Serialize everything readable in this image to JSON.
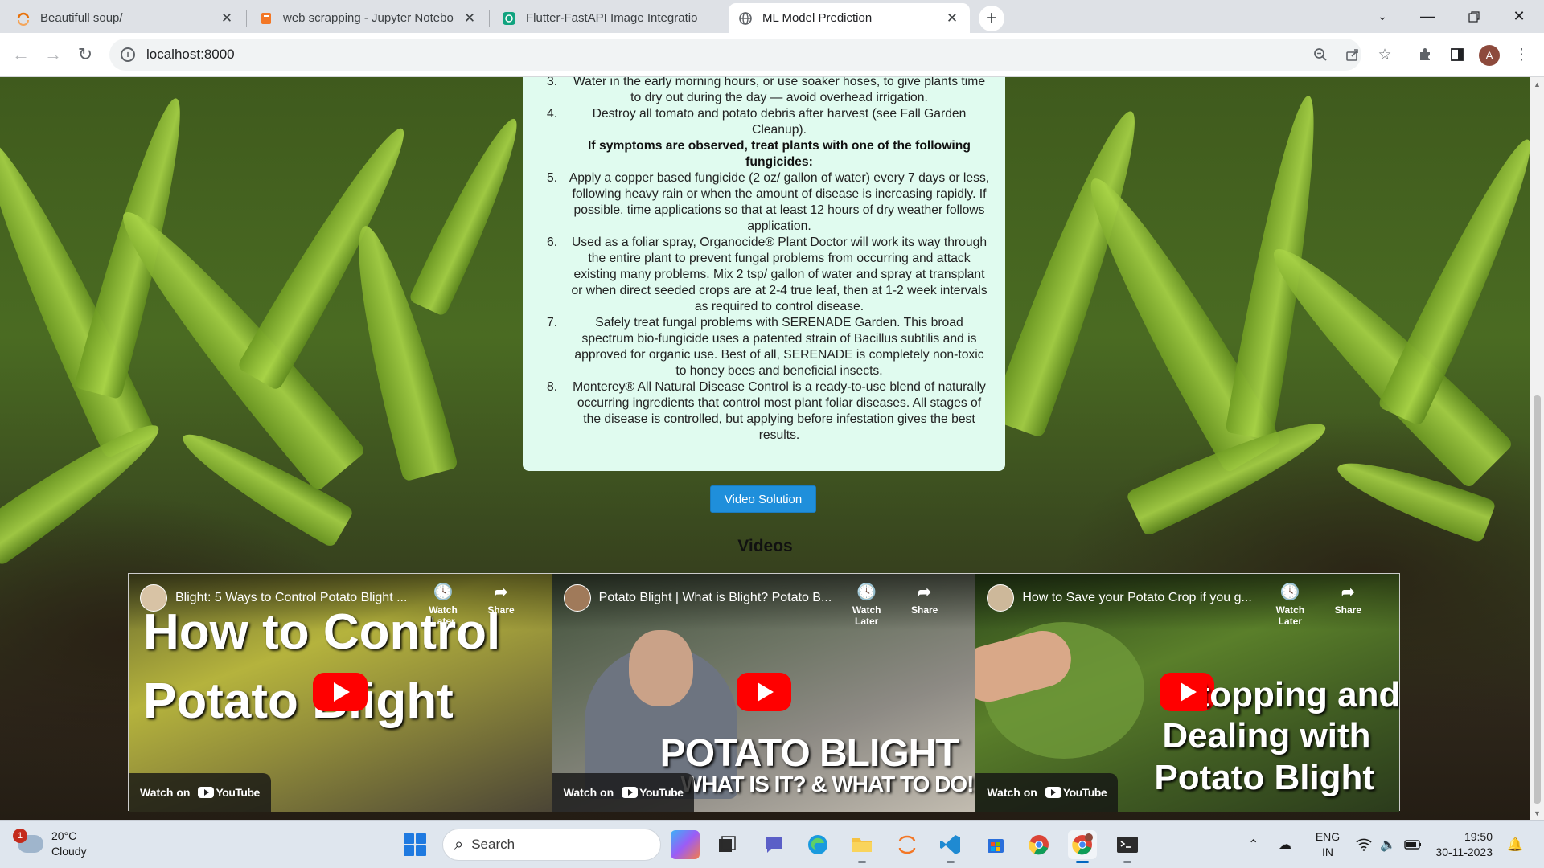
{
  "browser": {
    "tabs": [
      {
        "label": "Beautifull soup/",
        "icon": "spinner-icon"
      },
      {
        "label": "web scrapping - Jupyter Notebo",
        "icon": "jupyter-icon"
      },
      {
        "label": "Flutter-FastAPI Image Integratio",
        "icon": "chatgpt-icon"
      },
      {
        "label": "ML Model Prediction",
        "icon": "globe-icon",
        "active": true
      }
    ],
    "url": "localhost:8000",
    "avatar_letter": "A"
  },
  "card": {
    "items": [
      {
        "num": "3.",
        "text": "Water in the early morning hours, or use soaker hoses, to give plants time to dry out during the day — avoid overhead irrigation."
      },
      {
        "num": "4.",
        "text": "Destroy all tomato and potato debris after harvest (see Fall Garden Cleanup)."
      }
    ],
    "subheading": "If symptoms are observed, treat plants with one of the following fungicides:",
    "items2": [
      {
        "num": "5.",
        "text": "Apply a copper based fungicide (2 oz/ gallon of water) every 7 days or less, following heavy rain or when the amount of disease is increasing rapidly. If possible, time applications so that at least 12 hours of dry weather follows application."
      },
      {
        "num": "6.",
        "text": "Used as a foliar spray, Organocide® Plant Doctor will work its way through the entire plant to prevent fungal problems from occurring and attack existing many problems. Mix 2 tsp/ gallon of water and spray at transplant or when direct seeded crops are at 2-4 true leaf, then at 1-2 week intervals as required to control disease."
      },
      {
        "num": "7.",
        "text": "Safely treat fungal problems with SERENADE Garden. This broad spectrum bio-fungicide uses a patented strain of Bacillus subtilis and is approved for organic use. Best of all, SERENADE is completely non-toxic to honey bees and beneficial insects."
      },
      {
        "num": "8.",
        "text": "Monterey® All Natural Disease Control is a ready-to-use blend of naturally occurring ingredients that control most plant foliar diseases. All stages of the disease is controlled, but applying before infestation gives the best results."
      }
    ]
  },
  "video_button": "Video Solution",
  "videos_heading": "Videos",
  "videos": [
    {
      "title": "Blight: 5 Ways to Control Potato Blight ...",
      "overlay_lines": [
        "How to Control",
        "Potato Blight"
      ],
      "watch_later": "Watch Later",
      "share": "Share",
      "watch_on": "Watch on",
      "youtube": "YouTube"
    },
    {
      "title": "Potato Blight | What is Blight? Potato B...",
      "overlay_lines": [
        "POTATO BLIGHT",
        "WHAT IS IT? & WHAT TO DO!"
      ],
      "watch_later": "Watch Later",
      "share": "Share",
      "watch_on": "Watch on",
      "youtube": "YouTube"
    },
    {
      "title": "How to Save your Potato Crop if you g...",
      "overlay_lines": [
        "Stopping and",
        "Dealing with",
        "Potato Blight"
      ],
      "watch_later": "Watch Later",
      "share": "Share",
      "watch_on": "Watch on",
      "youtube": "YouTube"
    }
  ],
  "taskbar": {
    "weather_temp": "20°C",
    "weather_desc": "Cloudy",
    "weather_badge": "1",
    "search_placeholder": "Search",
    "lang_top": "ENG",
    "lang_bottom": "IN",
    "time": "19:50",
    "date": "30-11-2023"
  }
}
